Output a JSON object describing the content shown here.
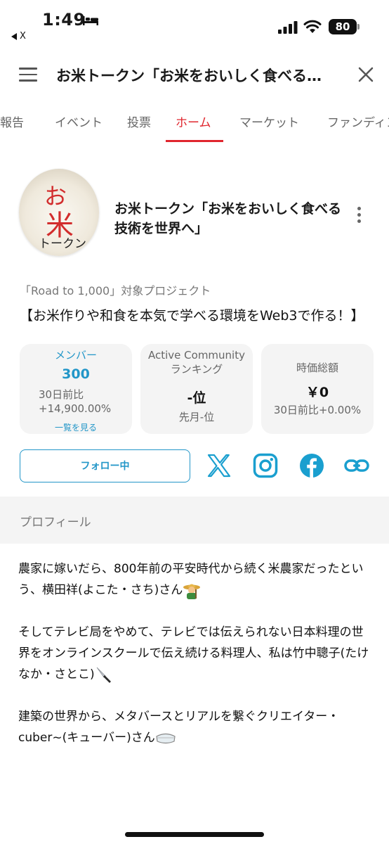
{
  "status_bar": {
    "time": "1:49",
    "back_app": "X",
    "battery": "80"
  },
  "header": {
    "title": "お米トークン「お米をおいしく食べる…"
  },
  "tabs": [
    {
      "label": "活動報告"
    },
    {
      "label": "イベント"
    },
    {
      "label": "投票"
    },
    {
      "label": "ホーム"
    },
    {
      "label": "マーケット"
    },
    {
      "label": "ファンディング"
    }
  ],
  "active_tab": "ホーム",
  "project": {
    "logo_text_1": "お",
    "logo_text_2": "米",
    "logo_text_3": "トークン",
    "name": "お米トークン「お米をおいしく食べる技術を世界へ」",
    "campaign": "「Road to 1,000」対象プロジェクト",
    "tagline": "【お米作りや和食を本気で学べる環境をWeb3で作る！】"
  },
  "stats": {
    "members": {
      "label": "メンバー",
      "value": "300",
      "change_label": "30日前比",
      "change": "+14,900.00%",
      "link": "一覧を見る"
    },
    "ranking": {
      "label_1": "Active Community",
      "label_2": "ランキング",
      "value": "-位",
      "prev": "先月-位"
    },
    "price": {
      "label": "時価総額",
      "value": "￥0",
      "change": "30日前比+0.00%"
    }
  },
  "follow": {
    "label": "フォロー中"
  },
  "profile": {
    "title": "プロフィール",
    "p1": "農家に嫁いだら、800年前の平安時代から続く米農家だったという、横田祥(よこた・さち)さん",
    "p2": "そしてテレビ局をやめて、テレビでは伝えられない日本料理の世界をオンラインスクールで伝え続ける料理人、私は竹中聰子(たけなか・さとこ)",
    "p3": "建築の世界から、メタバースとリアルを繋ぐクリエイター・cuber~(キューバー)さん"
  },
  "colors": {
    "accent_red": "#e0262e",
    "accent_blue": "#2296c8",
    "instagram": "#1a9fcf",
    "facebook": "#1a9fcf"
  },
  "icons": [
    "bed-icon",
    "signal-icon",
    "wifi-icon",
    "menu-icon",
    "close-icon",
    "kebab-icon",
    "x-logo-icon",
    "instagram-icon",
    "facebook-icon",
    "link-icon",
    "farmer-emoji-icon",
    "knife-emoji-icon",
    "goggles-emoji-icon"
  ]
}
